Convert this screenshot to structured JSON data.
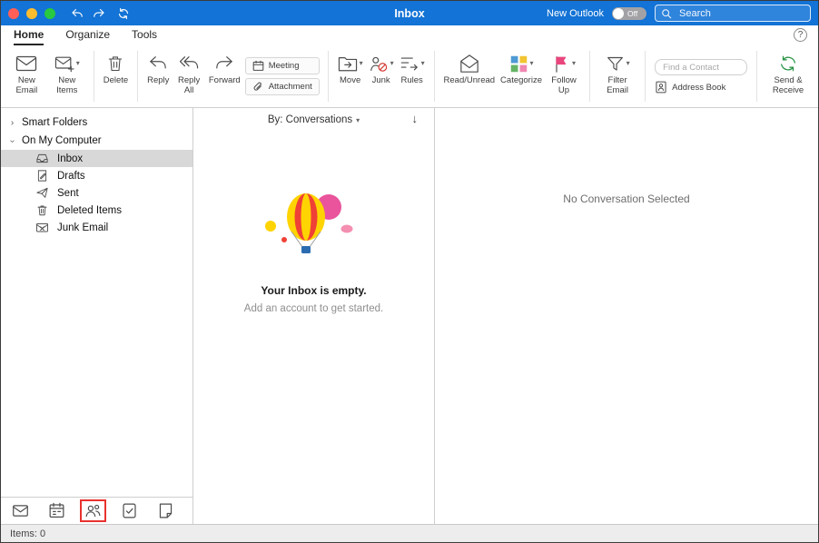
{
  "titlebar": {
    "title": "Inbox",
    "new_outlook_label": "New Outlook",
    "toggle_state": "Off",
    "search_placeholder": "Search"
  },
  "icons": {
    "help": "?",
    "chevron_down": "▾",
    "chevron_section": "›",
    "sort_arrow": "↓"
  },
  "tabs": {
    "home": "Home",
    "organize": "Organize",
    "tools": "Tools"
  },
  "ribbon": {
    "new_email": "New Email",
    "new_items": "New Items",
    "delete": "Delete",
    "reply": "Reply",
    "reply_all": "Reply All",
    "forward": "Forward",
    "meeting": "Meeting",
    "attachment": "Attachment",
    "move": "Move",
    "junk": "Junk",
    "rules": "Rules",
    "read_unread": "Read/Unread",
    "categorize": "Categorize",
    "follow_up": "Follow Up",
    "filter_email": "Filter Email",
    "find_contact_placeholder": "Find a Contact",
    "address_book": "Address Book",
    "send_receive": "Send & Receive"
  },
  "sidebar": {
    "sections": [
      {
        "label": "Smart Folders"
      },
      {
        "label": "On My Computer"
      }
    ],
    "folders": [
      {
        "label": "Inbox"
      },
      {
        "label": "Drafts"
      },
      {
        "label": "Sent"
      },
      {
        "label": "Deleted Items"
      },
      {
        "label": "Junk Email"
      }
    ]
  },
  "message_list": {
    "sort_label": "By: Conversations",
    "empty_title": "Your Inbox is empty.",
    "empty_subtitle": "Add an account to get started."
  },
  "reading_pane": {
    "empty_text": "No Conversation Selected"
  },
  "statusbar": {
    "items": "Items: 0"
  }
}
